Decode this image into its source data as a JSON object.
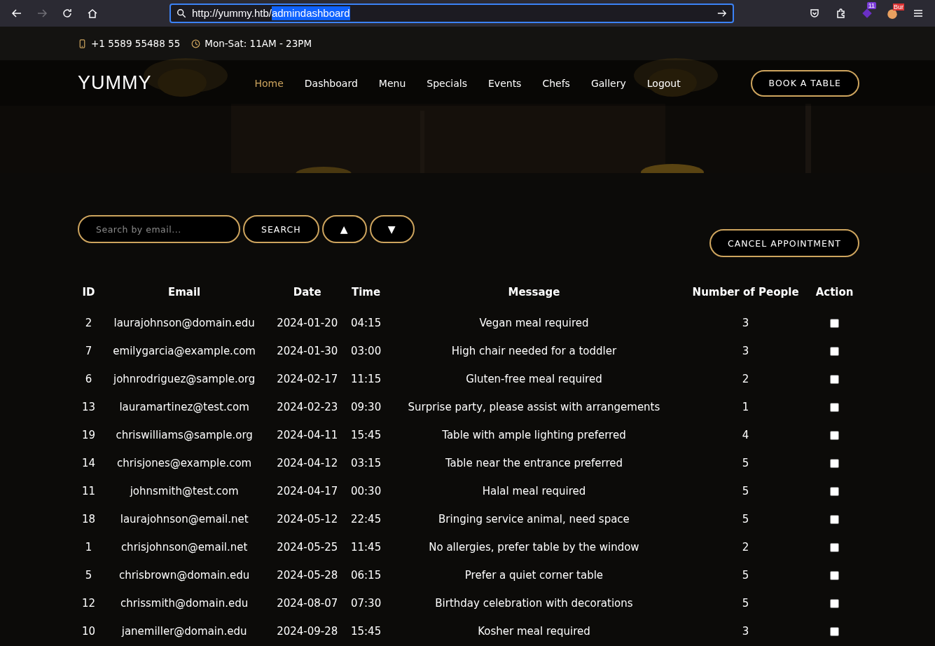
{
  "browser": {
    "back": {
      "disabled": false
    },
    "forward": {
      "disabled": true
    },
    "url": {
      "text": "http://yummy.htb/",
      "selected_text": "admindashboard"
    },
    "extension_badge": "11",
    "burp_label": "Bur"
  },
  "topbar": {
    "phone": "+1 5589 55488 55",
    "hours": "Mon-Sat: 11AM - 23PM"
  },
  "header": {
    "logo": "YUMMY",
    "nav": [
      {
        "label": "Home",
        "selected": true
      },
      {
        "label": "Dashboard",
        "selected": false
      },
      {
        "label": "Menu",
        "selected": false
      },
      {
        "label": "Specials",
        "selected": false
      },
      {
        "label": "Events",
        "selected": false
      },
      {
        "label": "Chefs",
        "selected": false
      },
      {
        "label": "Gallery",
        "selected": false
      },
      {
        "label": "Logout",
        "selected": false
      }
    ],
    "cta": "BOOK A TABLE"
  },
  "toolbar": {
    "search": {
      "placeholder": "Search by email..."
    },
    "search_button": "SEARCH",
    "sort_up": "▲",
    "sort_down": "▼",
    "cancel_button": "CANCEL APPOINTMENT"
  },
  "table": {
    "columns": [
      "ID",
      "Email",
      "Date",
      "Time",
      "Message",
      "Number of People",
      "Action"
    ],
    "rows": [
      {
        "id": "2",
        "email": "laurajohnson@domain.edu",
        "date": "2024-01-20",
        "time": "04:15",
        "message": "Vegan meal required",
        "people": "3",
        "checked": false
      },
      {
        "id": "7",
        "email": "emilygarcia@example.com",
        "date": "2024-01-30",
        "time": "03:00",
        "message": "High chair needed for a toddler",
        "people": "3",
        "checked": false
      },
      {
        "id": "6",
        "email": "johnrodriguez@sample.org",
        "date": "2024-02-17",
        "time": "11:15",
        "message": "Gluten-free meal required",
        "people": "2",
        "checked": false
      },
      {
        "id": "13",
        "email": "lauramartinez@test.com",
        "date": "2024-02-23",
        "time": "09:30",
        "message": "Surprise party, please assist with arrangements",
        "people": "1",
        "checked": false
      },
      {
        "id": "19",
        "email": "chriswilliams@sample.org",
        "date": "2024-04-11",
        "time": "15:45",
        "message": "Table with ample lighting preferred",
        "people": "4",
        "checked": false
      },
      {
        "id": "14",
        "email": "chrisjones@example.com",
        "date": "2024-04-12",
        "time": "03:15",
        "message": "Table near the entrance preferred",
        "people": "5",
        "checked": false
      },
      {
        "id": "11",
        "email": "johnsmith@test.com",
        "date": "2024-04-17",
        "time": "00:30",
        "message": "Halal meal required",
        "people": "5",
        "checked": false
      },
      {
        "id": "18",
        "email": "laurajohnson@email.net",
        "date": "2024-05-12",
        "time": "22:45",
        "message": "Bringing service animal, need space",
        "people": "5",
        "checked": false
      },
      {
        "id": "1",
        "email": "chrisjohnson@email.net",
        "date": "2024-05-25",
        "time": "11:45",
        "message": "No allergies, prefer table by the window",
        "people": "2",
        "checked": false
      },
      {
        "id": "5",
        "email": "chrisbrown@domain.edu",
        "date": "2024-05-28",
        "time": "06:15",
        "message": "Prefer a quiet corner table",
        "people": "5",
        "checked": false
      },
      {
        "id": "12",
        "email": "chrissmith@domain.edu",
        "date": "2024-08-07",
        "time": "07:30",
        "message": "Birthday celebration with decorations",
        "people": "5",
        "checked": false
      },
      {
        "id": "10",
        "email": "janemiller@domain.edu",
        "date": "2024-09-28",
        "time": "15:45",
        "message": "Kosher meal required",
        "people": "3",
        "checked": false
      }
    ]
  }
}
